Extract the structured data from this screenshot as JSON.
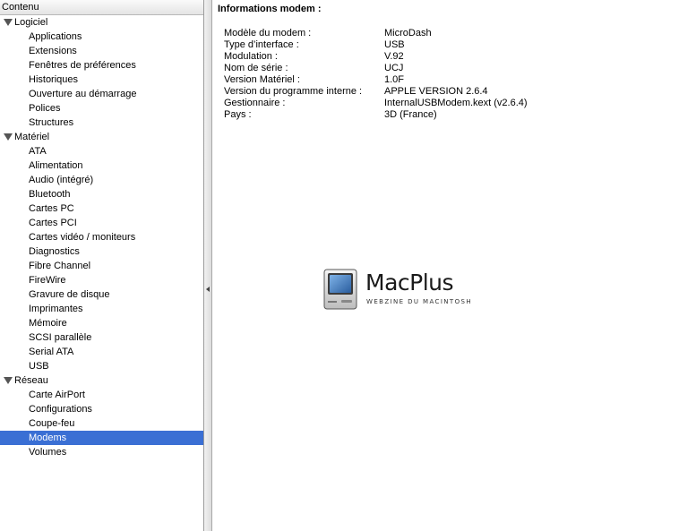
{
  "sidebar": {
    "header": "Contenu",
    "groups": [
      {
        "label": "Logiciel",
        "items": [
          "Applications",
          "Extensions",
          "Fenêtres de préférences",
          "Historiques",
          "Ouverture au démarrage",
          "Polices",
          "Structures"
        ]
      },
      {
        "label": "Matériel",
        "items": [
          "ATA",
          "Alimentation",
          "Audio (intégré)",
          "Bluetooth",
          "Cartes PC",
          "Cartes PCI",
          "Cartes vidéo / moniteurs",
          "Diagnostics",
          "Fibre Channel",
          "FireWire",
          "Gravure de disque",
          "Imprimantes",
          "Mémoire",
          "SCSI parallèle",
          "Serial ATA",
          "USB"
        ]
      },
      {
        "label": "Réseau",
        "items": [
          "Carte AirPort",
          "Configurations",
          "Coupe-feu",
          "Modems",
          "Volumes"
        ]
      }
    ],
    "selected": "Modems"
  },
  "content": {
    "title": "Informations modem :",
    "rows": [
      {
        "label": "Modèle du modem :",
        "value": "MicroDash"
      },
      {
        "label": "Type d’interface :",
        "value": "USB"
      },
      {
        "label": "Modulation :",
        "value": "V.92"
      },
      {
        "label": "Nom de série :",
        "value": "UCJ"
      },
      {
        "label": "Version Matériel :",
        "value": "1.0F"
      },
      {
        "label": "Version du programme interne :",
        "value": "APPLE VERSION 2.6.4"
      },
      {
        "label": "Gestionnaire :",
        "value": "InternalUSBModem.kext (v2.6.4)"
      },
      {
        "label": "Pays :",
        "value": "3D (France)"
      }
    ]
  },
  "watermark": {
    "word": "MacPlus",
    "tagline": "WEBZINE DU MACINTOSH",
    "icon": "classic-mac-icon"
  },
  "colors": {
    "selection": "#3a6fd4",
    "selection_text": "#ffffff"
  }
}
